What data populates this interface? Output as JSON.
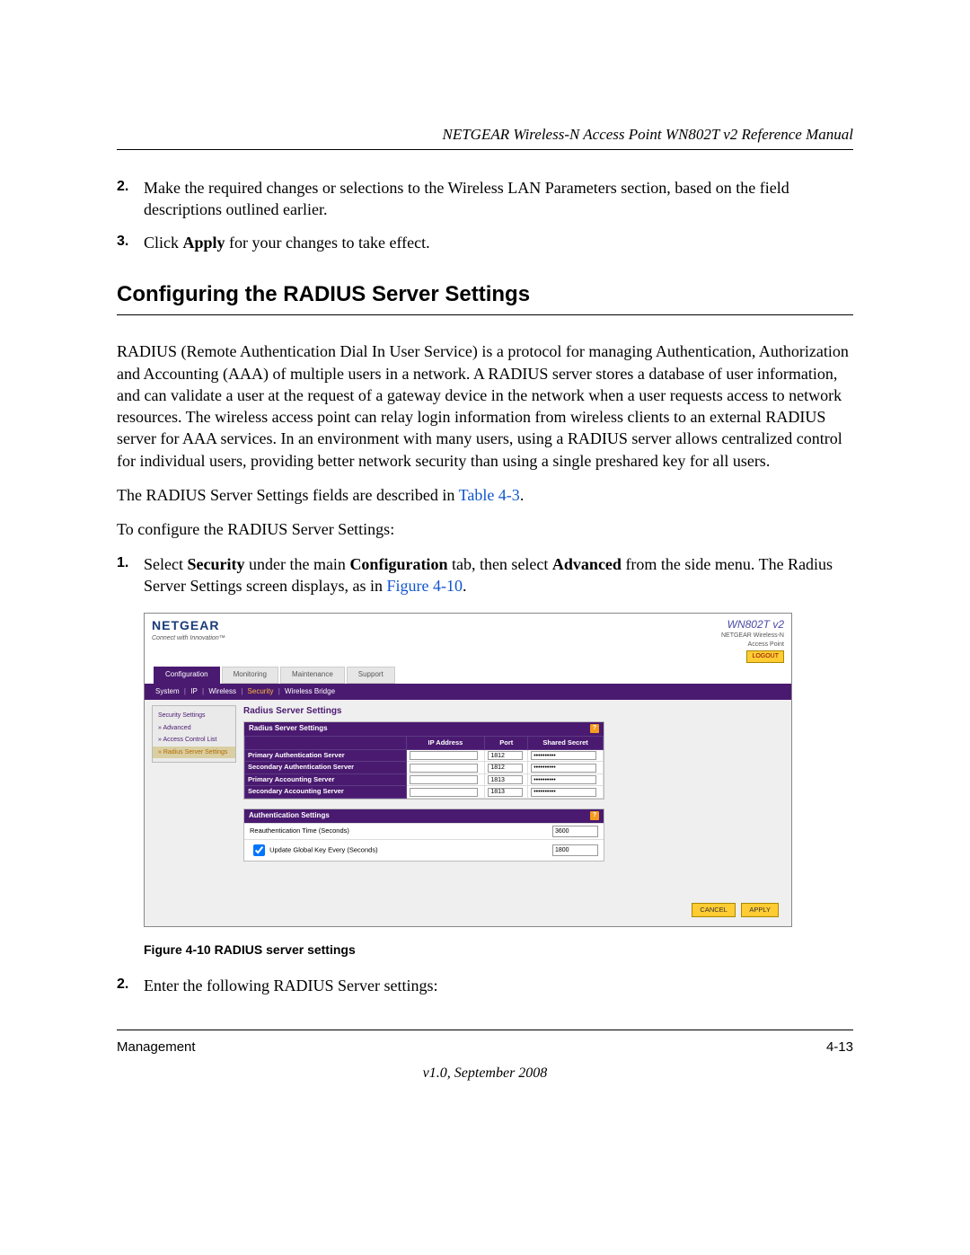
{
  "header": {
    "title": "NETGEAR Wireless-N Access Point WN802T v2 Reference Manual"
  },
  "step2": {
    "num": "2.",
    "text": "Make the required changes or selections to the Wireless LAN Parameters section, based on the field descriptions outlined earlier."
  },
  "step3": {
    "num": "3.",
    "pre": "Click ",
    "bold": "Apply",
    "post": " for your changes to take effect."
  },
  "section_title": "Configuring the RADIUS Server Settings",
  "para1": "RADIUS (Remote Authentication Dial In User Service) is a protocol for managing Authentication, Authorization and Accounting (AAA) of multiple users in a network. A RADIUS server stores a database of user information, and can validate a user at the request of a gateway device in the network when a user requests access to network resources. The wireless access point can relay login information from wireless clients to an external RADIUS server for AAA services. In an environment with many users, using a RADIUS server allows centralized control for individual users, providing better network security than using a single preshared key for all users.",
  "para2": {
    "pre": "The RADIUS Server Settings fields are described in ",
    "link": "Table 4-3",
    "post": "."
  },
  "para3": "To configure the RADIUS Server Settings:",
  "step_a": {
    "num": "1.",
    "p1_pre": "Select ",
    "p1_b1": "Security",
    "p1_mid": " under the main ",
    "p1_b2": "Configuration",
    "p1_mid2": " tab, then select ",
    "p1_b3": "Advanced",
    "p1_post": " from the side menu. The Radius Server Settings screen displays, as in ",
    "link": "Figure 4-10",
    "end": "."
  },
  "screenshot": {
    "logo": "NETGEAR",
    "logo_sub": "Connect with Innovation™",
    "model_line1a": "WN802T",
    "model_line1b": "v2",
    "model_line2": "NETGEAR Wireless‑N",
    "model_line3": "Access Point",
    "logout": "LOGOUT",
    "tabs": [
      "Configuration",
      "Monitoring",
      "Maintenance",
      "Support"
    ],
    "tab_active_index": 0,
    "subnav": {
      "items": [
        "System",
        "IP",
        "Wireless",
        "Security",
        "Wireless Bridge"
      ],
      "selected_index": 3,
      "sep": "|"
    },
    "sidebar": {
      "items": [
        {
          "label": "Security Settings",
          "selected": false
        },
        {
          "label": "» Advanced",
          "selected": false
        },
        {
          "label": "» Access Control List",
          "selected": false
        },
        {
          "label": "» Radius Server Settings",
          "selected": true
        }
      ]
    },
    "content_title": "Radius Server Settings",
    "radius_panel": {
      "header": "Radius Server Settings",
      "help_icon": "?",
      "col_headers": [
        "",
        "IP Address",
        "Port",
        "Shared Secret"
      ],
      "rows": [
        {
          "label": "Primary Authentication Server",
          "ip": "",
          "port": "1812",
          "secret": "••••••••••"
        },
        {
          "label": "Secondary Authentication Server",
          "ip": "",
          "port": "1812",
          "secret": "••••••••••"
        },
        {
          "label": "Primary Accounting Server",
          "ip": "",
          "port": "1813",
          "secret": "••••••••••"
        },
        {
          "label": "Secondary Accounting Server",
          "ip": "",
          "port": "1813",
          "secret": "••••••••••"
        }
      ]
    },
    "auth_panel": {
      "header": "Authentication Settings",
      "help_icon": "?",
      "rows": [
        {
          "label": "Reauthentication Time (Seconds)",
          "checkbox": false,
          "value": "3600"
        },
        {
          "label": "Update Global Key Every (Seconds)",
          "checkbox": true,
          "value": "1800"
        }
      ]
    },
    "buttons": {
      "cancel": "CANCEL",
      "apply": "APPLY"
    }
  },
  "figure_caption": "Figure 4-10  RADIUS server settings",
  "step_b": {
    "num": "2.",
    "text": "Enter the following RADIUS Server settings:"
  },
  "footer": {
    "left": "Management",
    "right": "4-13",
    "version": "v1.0, September 2008"
  }
}
